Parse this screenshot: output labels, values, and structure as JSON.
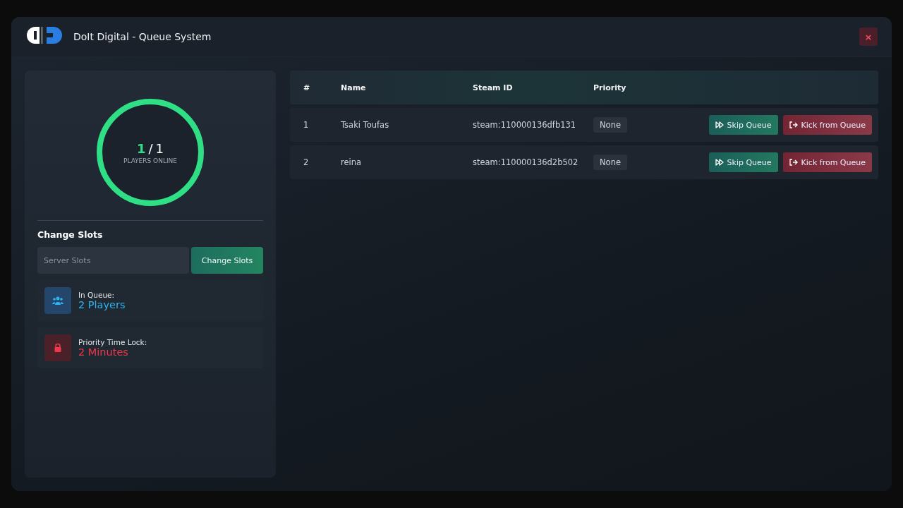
{
  "window": {
    "title": "DoIt Digital - Queue System",
    "close": "×"
  },
  "online": {
    "current": "1",
    "separator": "/",
    "max": "1",
    "label": "PLAYERS ONLINE",
    "level": 1
  },
  "slots": {
    "heading": "Change Slots",
    "placeholder": "Server Slots",
    "button": "Change Slots"
  },
  "stats": [
    {
      "kind": "queue",
      "label": "In Queue:",
      "value": "2 Players",
      "color": "#2fb4f0"
    },
    {
      "kind": "lock",
      "label": "Priority Time Lock:",
      "value": "2 Minutes",
      "color": "#f0384a"
    }
  ],
  "table": {
    "columns": [
      "#",
      "Name",
      "Steam ID",
      "Priority"
    ],
    "rows": [
      {
        "number": "1",
        "name": "Tsaki Toufas",
        "steam_id": "steam:110000136dfb131",
        "priority": "None",
        "skip": "Skip Queue",
        "kick": "Kick from Queue"
      },
      {
        "number": "2",
        "name": "reina",
        "steam_id": "steam:110000136d2b502",
        "priority": "None",
        "skip": "Skip Queue",
        "kick": "Kick from Queue"
      }
    ]
  }
}
